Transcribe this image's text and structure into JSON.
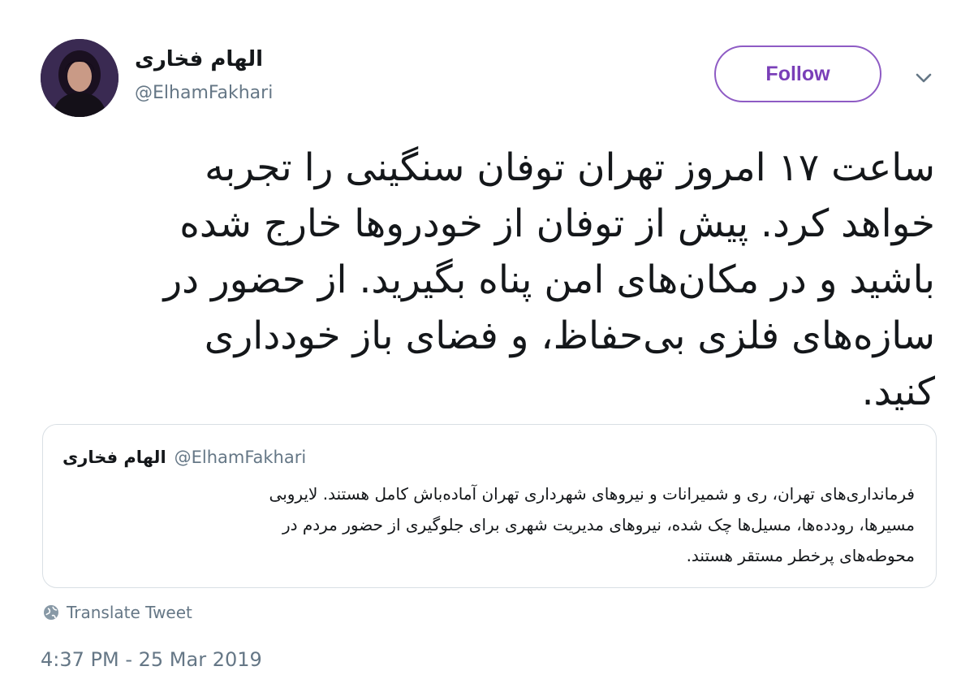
{
  "author": {
    "display_name": "الهام فخاری",
    "handle": "@ElhamFakhari",
    "avatar_icon": "profile-photo"
  },
  "follow": {
    "label": "Follow",
    "accent_color": "#7a3fb8"
  },
  "menu": {
    "icon": "chevron-down-icon"
  },
  "tweet": {
    "text": "ساعت ۱۷ امروز تهران توفان سنگینی را تجربه\nخواهد کرد. پیش از توفان از خودروها خارج شده\nباشید و در مکان‌های امن پناه بگیرید. از حضور در\nسازه‌های فلزی بی‌حفاظ، و فضای باز خودداری\nکنید."
  },
  "quoted_tweet": {
    "display_name": "الهام فخاری",
    "handle": "@ElhamFakhari",
    "text": "فرمانداری‌های تهران، ری و شمیرانات و نیروهای شهرداری تهران آماده‌باش کامل  هستند. لایروبی\nمسیرها، رودده‌ها، مسیل‌ها چک شده، نیروهای مدیریت شهری برای جلوگیری از حضور مردم در\nمحوطه‌های پرخطر مستقر هستند."
  },
  "translate": {
    "label": "Translate Tweet",
    "icon": "globe-icon"
  },
  "timestamp": "4:37 PM - 25 Mar 2019"
}
